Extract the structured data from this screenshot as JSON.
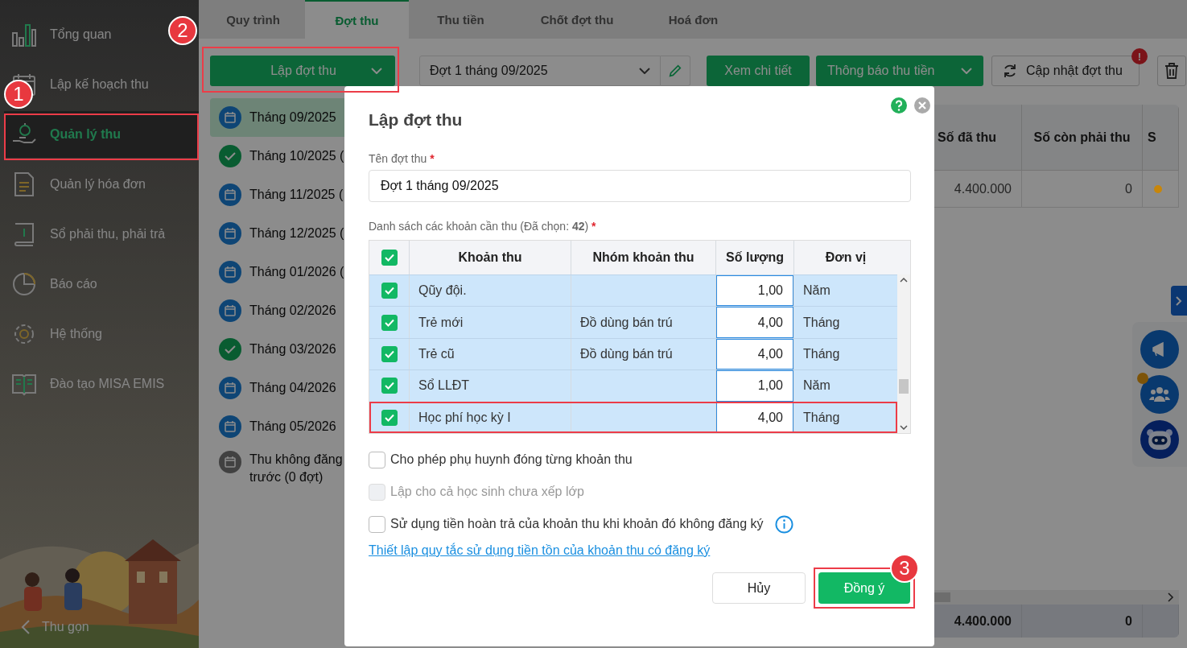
{
  "sidebar": {
    "items": [
      {
        "label": "Tổng quan",
        "selected": false
      },
      {
        "label": "Lập kế hoạch thu",
        "selected": false
      },
      {
        "label": "Quản lý thu",
        "selected": true
      },
      {
        "label": "Quản lý hóa đơn",
        "selected": false
      },
      {
        "label": "Sổ phải thu, phải trả",
        "selected": false
      },
      {
        "label": "Báo cáo",
        "selected": false
      },
      {
        "label": "Hệ thống",
        "selected": false
      },
      {
        "label": "Đào tạo MISA EMIS",
        "selected": false
      }
    ],
    "collapse_label": "Thu gọn"
  },
  "tabs": [
    {
      "label": "Quy trình",
      "selected": false
    },
    {
      "label": "Đợt thu",
      "selected": true
    },
    {
      "label": "Thu tiền",
      "selected": false
    },
    {
      "label": "Chốt đợt thu",
      "selected": false
    },
    {
      "label": "Hoá đơn",
      "selected": false
    }
  ],
  "toolbar": {
    "create_button": "Lập đợt thu",
    "period_select": "Đợt 1 tháng 09/2025",
    "view_button": "Xem chi tiết",
    "notify_button": "Thông báo thu tiền",
    "update_button": "Cập nhật đợt thu",
    "update_alert": "!"
  },
  "periods": [
    {
      "label": "Tháng 09/2025",
      "kind": "plan",
      "selected": true
    },
    {
      "label": "Tháng 10/2025 (",
      "kind": "done",
      "selected": false
    },
    {
      "label": "Tháng 11/2025 (",
      "kind": "plan",
      "selected": false
    },
    {
      "label": "Tháng 12/2025 (",
      "kind": "plan",
      "selected": false
    },
    {
      "label": "Tháng 01/2026 (",
      "kind": "plan",
      "selected": false
    },
    {
      "label": "Tháng 02/2026",
      "kind": "plan",
      "selected": false
    },
    {
      "label": "Tháng 03/2026",
      "kind": "done",
      "selected": false
    },
    {
      "label": "Tháng 04/2026",
      "kind": "plan",
      "selected": false
    },
    {
      "label": "Tháng 05/2026",
      "kind": "plan",
      "selected": false
    },
    {
      "label": "Thu không đăng trước (0 đợt)",
      "kind": "other",
      "selected": false
    }
  ],
  "table": {
    "columns": [
      "Số đã thu",
      "Số còn phải thu",
      "S"
    ],
    "rows": [
      {
        "cells": [
          "4.400.000",
          "0"
        ],
        "color": "#c8860a"
      }
    ],
    "totals": [
      "4.400.000",
      "0"
    ]
  },
  "dialog": {
    "title": "Lập đợt thu",
    "name_label": "Tên đợt thu",
    "name_value": "Đợt 1 tháng 09/2025",
    "required_mark": "*",
    "list_label": "Danh sách các khoản cần thu (Đã chọn: **42**)",
    "all_checked": true,
    "columns": [
      "Khoản thu",
      "Nhóm khoản thu",
      "Số lượng",
      "Đơn vị"
    ],
    "rows": [
      {
        "item": "Qũy đội.",
        "group": "",
        "quantity": "1,00",
        "unit": "Năm",
        "checked": true,
        "highlighted": false
      },
      {
        "item": "Trẻ mới",
        "group": "Đồ dùng bán trú",
        "quantity": "4,00",
        "unit": "Tháng",
        "checked": true,
        "highlighted": false
      },
      {
        "item": "Trẻ cũ",
        "group": "Đồ dùng bán trú",
        "quantity": "4,00",
        "unit": "Tháng",
        "checked": true,
        "highlighted": false
      },
      {
        "item": "Sổ LLĐT",
        "group": "",
        "quantity": "1,00",
        "unit": "Năm",
        "checked": true,
        "highlighted": false
      },
      {
        "item": "Học phí học kỳ I",
        "group": "",
        "quantity": "4,00",
        "unit": "Tháng",
        "checked": true,
        "highlighted": true
      }
    ],
    "options": [
      {
        "label": "Cho phép phụ huynh đóng từng khoản thu",
        "checked": false,
        "disabled": false,
        "info": false
      },
      {
        "label": "Lập cho cả học sinh chưa xếp lớp",
        "checked": false,
        "disabled": true,
        "info": false
      },
      {
        "label": "Sử dụng tiền hoàn trả của khoản thu khi khoản đó không đăng ký",
        "checked": false,
        "disabled": false,
        "info": true
      }
    ],
    "link": "Thiết lập quy tắc sử dụng tiền tồn của khoản thu có đăng ký",
    "cancel_button": "Hủy",
    "ok_button": "Đồng ý",
    "ok_highlighted": true
  },
  "callouts": [
    "1",
    "2",
    "3"
  ]
}
